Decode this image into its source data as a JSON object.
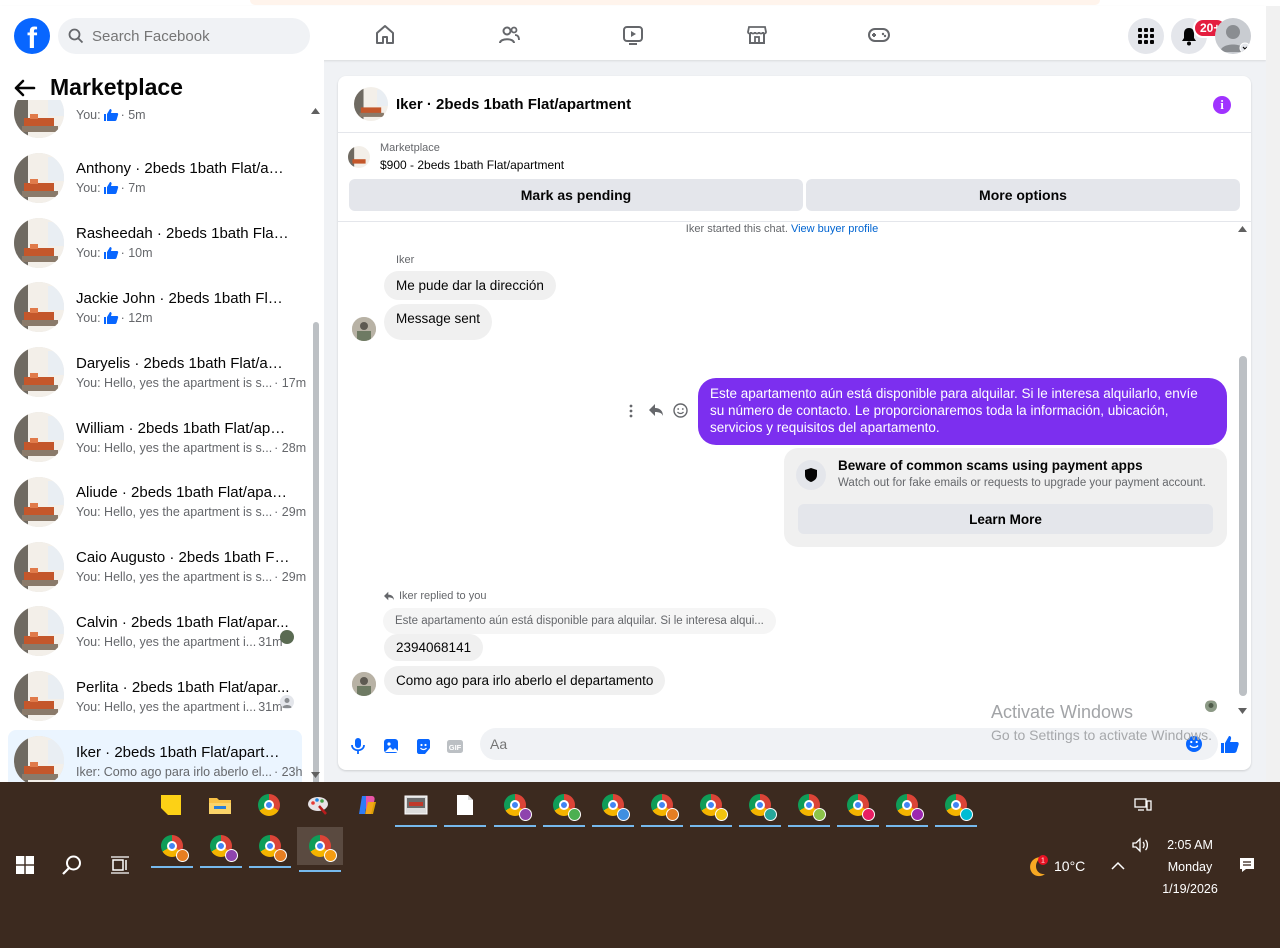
{
  "header": {
    "search_placeholder": "Search Facebook",
    "notification_count": "20+",
    "nav_icons": [
      "home-icon",
      "friends-icon",
      "video-icon",
      "marketplace-icon",
      "gaming-icon"
    ]
  },
  "sidebar": {
    "title": "Marketplace",
    "conversations": [
      {
        "name": "",
        "sub": "You:",
        "time": "· 5m",
        "like": true
      },
      {
        "name": "Anthony · 2beds 1bath Flat/apar...",
        "sub": "You:",
        "time": "· 7m",
        "like": true
      },
      {
        "name": "Rasheedah · 2beds 1bath Flat/a...",
        "sub": "You:",
        "time": "· 10m",
        "like": true
      },
      {
        "name": "Jackie John · 2beds 1bath Flat/a...",
        "sub": "You:",
        "time": "· 12m",
        "like": true
      },
      {
        "name": "Daryelis · 2beds 1bath Flat/apart...",
        "sub": "You: Hello, yes the apartment is s...",
        "time": "· 17m",
        "like": false
      },
      {
        "name": "William · 2beds 1bath Flat/apart...",
        "sub": "You: Hello, yes the apartment is s...",
        "time": "· 28m",
        "like": false
      },
      {
        "name": "Aliude · 2beds 1bath Flat/apart...",
        "sub": "You: Hello, yes the apartment is s...",
        "time": "· 29m",
        "like": false
      },
      {
        "name": "Caio Augusto · 2beds 1bath Flat...",
        "sub": "You: Hello, yes the apartment is s...",
        "time": "· 29m",
        "like": false
      },
      {
        "name": "Calvin · 2beds 1bath Flat/apar...",
        "sub": "You: Hello, yes the apartment i...",
        "time": "31m",
        "like": false
      },
      {
        "name": "Perlita · 2beds 1bath Flat/apar...",
        "sub": "You: Hello, yes the apartment i...",
        "time": "31m",
        "like": false
      },
      {
        "name": "Iker · 2beds 1bath Flat/apartment",
        "sub": "Iker: Como ago para irlo aberlo el...",
        "time": "· 23h",
        "like": false
      }
    ]
  },
  "chat": {
    "title": "Iker · 2beds 1bath Flat/apartment",
    "listing_label": "Marketplace",
    "listing_price": "$900 - 2beds 1bath Flat/apartment",
    "mark_pending": "Mark as pending",
    "more_options": "More options",
    "started_text": "Iker started this chat.",
    "view_profile": "View buyer profile",
    "sender_name": "Iker",
    "msg1": "Me pude dar la dirección",
    "msg2": "Message sent",
    "my_msg": "Este apartamento aún está disponible para alquilar. Si le interesa alquilarlo, envíe su número de contacto. Le proporcionaremos toda la información, ubicación, servicios y requisitos del apartamento.",
    "scam_title": "Beware of common scams using payment apps",
    "scam_sub": "Watch out for fake emails or requests to upgrade your payment account.",
    "learn_more": "Learn More",
    "replied_label": "Iker replied to you",
    "quoted": "Este apartamento aún está disponible para alquilar. Si le interesa alqui...",
    "msg3": "2394068141",
    "msg4": "Como ago para irlo aberlo el departamento",
    "composer_placeholder": "Aa"
  },
  "watermark": {
    "line1": "Activate Windows",
    "line2": "Go to Settings to activate Windows."
  },
  "taskbar": {
    "temperature": "10°C",
    "weather_badge": "1",
    "time": "2:05 AM",
    "day": "Monday",
    "date": "1/19/2026"
  },
  "colors": {
    "brand": "#0866ff",
    "my_bubble": "#7c2fef",
    "badge": "#e41e3f",
    "taskbar": "#3c2a1f"
  }
}
